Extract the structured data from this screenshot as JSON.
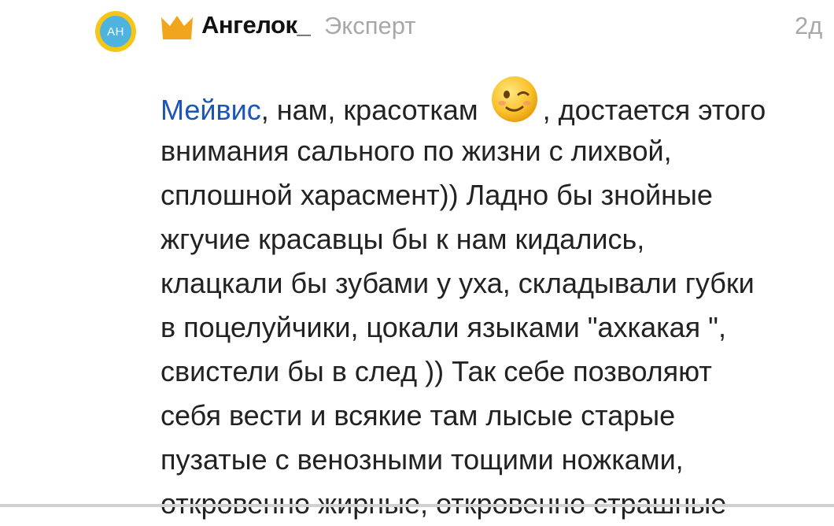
{
  "comment": {
    "avatar_initials": "AH",
    "author_name": "Ангелок_",
    "author_rank": "Эксперт",
    "timestamp": "2д",
    "mention": "Мейвис",
    "line1_after_mention": ", нам, красоткам ",
    "line1_after_emoji": ", достается этого",
    "lines": [
      "внимания сального по жизни с лихвой,",
      "сплошной харасмент)) Ладно бы знойные",
      "жгучие красавцы бы к нам кидались,",
      "клацкали бы зубами у уха, складывали губки",
      "в поцелуйчики, цокали языками \"ахкакая \",",
      "свистели бы в след )) Так себе позволяют",
      "себя вести и всякие там лысые старые",
      "пузатые с венозными тощими ножками,",
      "откровенно жирные, откровенно страшные"
    ]
  },
  "icons": {
    "crown": "crown-icon",
    "emoji": "wink-emoji-icon"
  },
  "colors": {
    "mention": "#1a55b8",
    "avatar_ring": "#f5c518",
    "avatar_fill": "#4fb3e0",
    "crown": "#f0a51c",
    "meta_text": "#a8a8a8"
  }
}
